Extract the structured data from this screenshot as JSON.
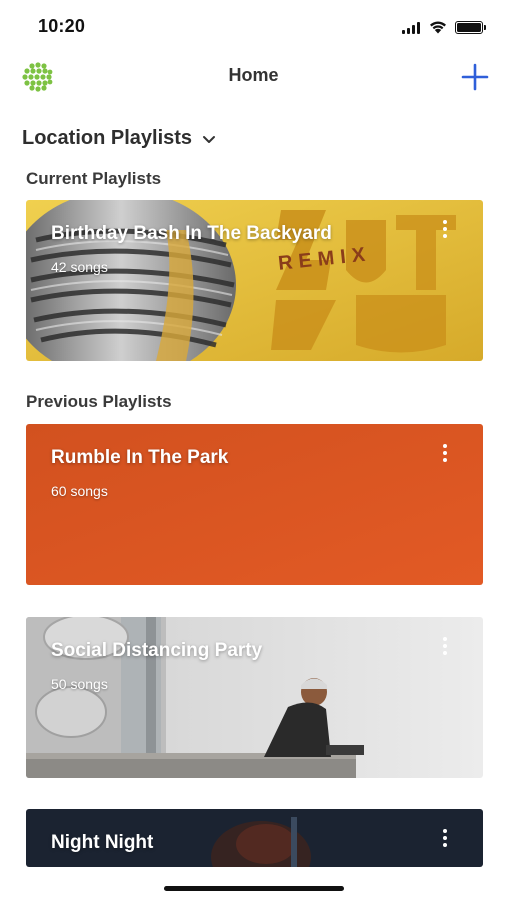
{
  "status_bar": {
    "time": "10:20"
  },
  "header": {
    "title": "Home",
    "logo_icon": "green-dotted-globe-logo",
    "add_icon": "plus-icon",
    "accent_color": "#2f5fd9"
  },
  "location": {
    "title": "Location Playlists",
    "dropdown_icon": "chevron-down-icon"
  },
  "sections": {
    "current_label": "Current Playlists",
    "previous_label": "Previous Playlists"
  },
  "current_playlists": [
    {
      "title": "Birthday Bash In The Backyard",
      "count": "42 songs",
      "art_text": "REMIX",
      "art_color": "#e3bf3a"
    }
  ],
  "previous_playlists": [
    {
      "title": "Rumble In The Park",
      "count": "60 songs",
      "art_color": "#dd5522"
    },
    {
      "title": "Social Distancing Party",
      "count": "50 songs",
      "art_color": "#d8d8d8"
    },
    {
      "title": "Night Night",
      "art_color": "#1a2230"
    }
  ]
}
